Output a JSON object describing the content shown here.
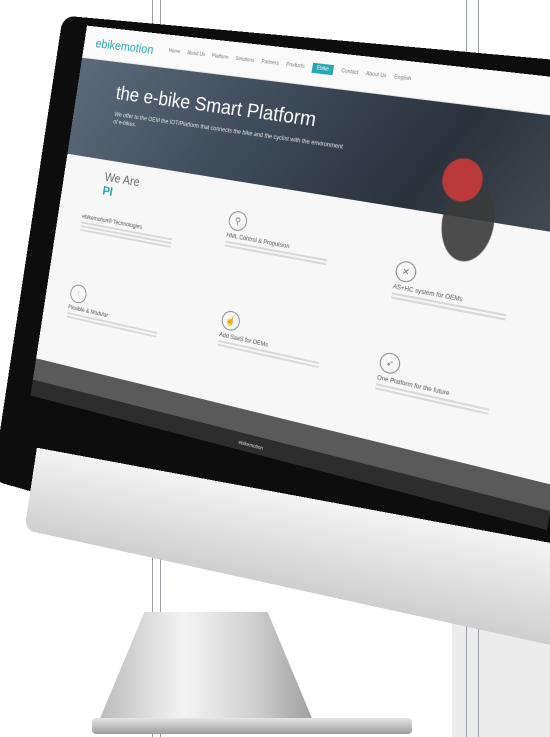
{
  "site": {
    "logo_text": "ebikemotion",
    "nav_items": [
      "Home",
      "About Us",
      "Platform",
      "Solutions",
      "Partners",
      "Products",
      "Ebike",
      "Contact",
      "About Us",
      "English"
    ],
    "active_nav_index": 6
  },
  "hero": {
    "title": "the e-bike Smart Platform",
    "subtitle": "We offer to the OEM the IOT/Platform that connects the bike and the cyclist with the environment of e-bikes."
  },
  "content": {
    "we_are_label": "We Are",
    "pi_label": "PI"
  },
  "features": [
    {
      "icon": "ebike-technologies-icon",
      "title": "ebikemotion® Technologies"
    },
    {
      "icon": "bicycle-icon",
      "title": "HMI, Control & Propulsion"
    },
    {
      "icon": "tools-icon",
      "title": "AS+HC system for OEMs"
    },
    {
      "icon": "sliders-icon",
      "title": "Flexible & Modular"
    },
    {
      "icon": "touch-icon",
      "title": "Add SaaS for OEMs"
    },
    {
      "icon": "rocket-icon",
      "title": "One Platform for the future"
    }
  ],
  "footer": {
    "text": "ebikemotion"
  },
  "colors": {
    "accent": "#2aa6b3",
    "background_panel": "#ececec"
  }
}
